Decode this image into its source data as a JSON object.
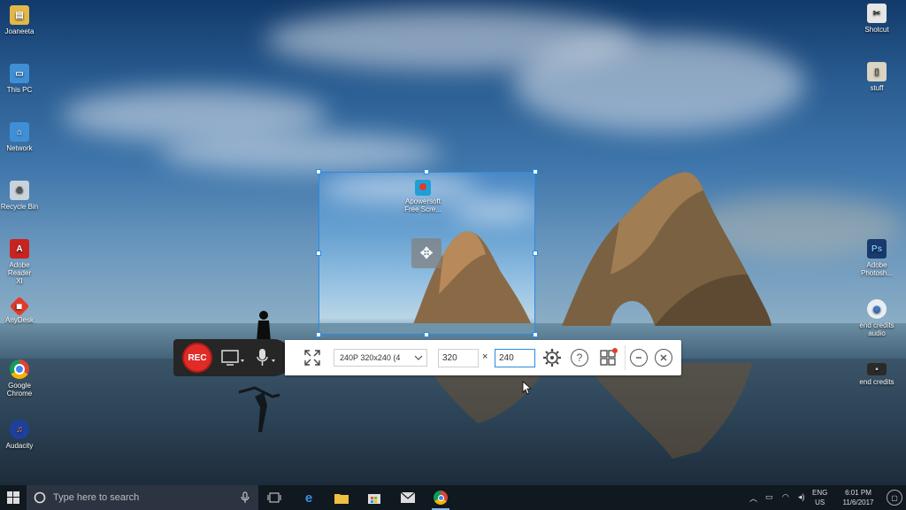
{
  "desktop": {
    "icons_left": [
      {
        "label": "Joaneeta",
        "icon": "user-folder-icon"
      },
      {
        "label": "This PC",
        "icon": "computer-icon"
      },
      {
        "label": "Network",
        "icon": "network-icon"
      },
      {
        "label": "Recycle Bin",
        "icon": "recycle-bin-icon"
      },
      {
        "label": "Adobe Reader XI",
        "icon": "pdf-icon"
      },
      {
        "label": "AnyDesk",
        "icon": "anydesk-icon"
      },
      {
        "label": "Google Chrome",
        "icon": "chrome-icon"
      },
      {
        "label": "Audacity",
        "icon": "audacity-icon"
      }
    ],
    "icons_right": [
      {
        "label": "Shotcut",
        "icon": "shotcut-icon"
      },
      {
        "label": "stuff",
        "icon": "folder-icon"
      },
      {
        "label": "Adobe Photosh...",
        "icon": "photoshop-icon"
      },
      {
        "label": "end credits audio",
        "icon": "audio-file-icon"
      },
      {
        "label": "end credits",
        "icon": "video-file-icon"
      }
    ],
    "capture_icon_label": "Apowersoft Free Scre..."
  },
  "recorder": {
    "rec_label": "REC",
    "resolution": "240P 320x240 (4",
    "width": "320",
    "height": "240",
    "times_symbol": "×",
    "help": "?"
  },
  "taskbar": {
    "search_placeholder": "Type here to search",
    "lang_line1": "ENG",
    "lang_line2": "US",
    "time": "6:01 PM",
    "date": "11/6/2017"
  }
}
